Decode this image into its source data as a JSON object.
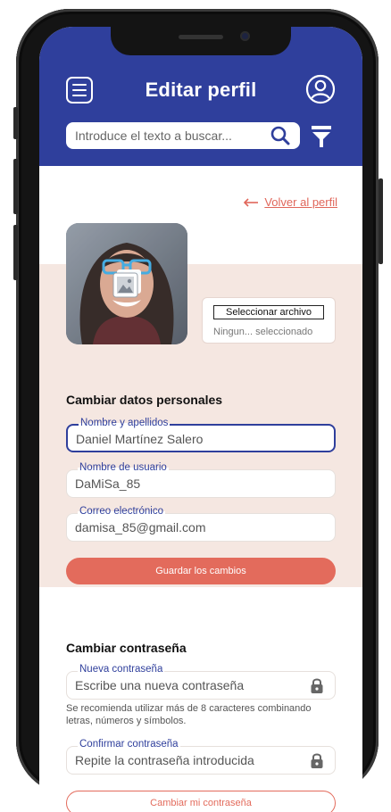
{
  "header": {
    "title": "Editar perfil",
    "menu_icon": "hamburger-menu-icon",
    "profile_icon": "user-circle-icon",
    "accent_color": "#2f3f9c"
  },
  "search": {
    "placeholder": "Introduce el texto a buscar...",
    "search_icon": "search-icon",
    "filter_icon": "filter-icon"
  },
  "back_link": {
    "label": "Volver al perfil",
    "arrow_icon": "arrow-left-icon",
    "color": "#e0665a"
  },
  "photo": {
    "image_icon": "image-icon",
    "file_button": "Seleccionar archivo",
    "file_status": "Ningun... seleccionado"
  },
  "personal": {
    "title": "Cambiar datos personales",
    "fields": [
      {
        "label": "Nombre y apellidos",
        "value": "Daniel Martínez Salero"
      },
      {
        "label": "Nombre de usuario",
        "value": "DaMiSa_85"
      },
      {
        "label": "Correo electrónico",
        "value": "damisa_85@gmail.com"
      }
    ],
    "save_button": "Guardar los cambios"
  },
  "password": {
    "title": "Cambiar contraseña",
    "new_label": "Nueva contraseña",
    "new_placeholder": "Escribe una nueva contraseña",
    "hint": "Se recomienda utilizar más de 8 caracteres combinando letras, números y símbolos.",
    "confirm_label": "Confirmar contraseña",
    "confirm_placeholder": "Repite la contraseña introducida",
    "lock_icon": "lock-icon",
    "change_button": "Cambiar mi contraseña"
  },
  "colors": {
    "primary": "#2f3f9c",
    "coral": "#e36b5c",
    "panel": "#f5e7e1"
  }
}
